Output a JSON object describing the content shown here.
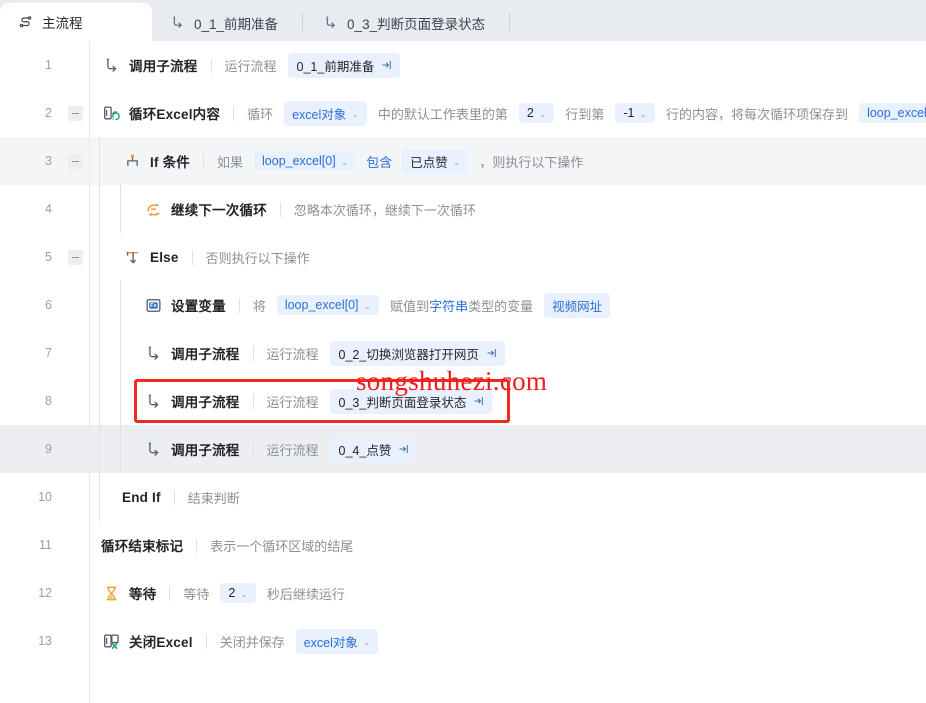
{
  "window": {
    "title": "主流程",
    "accent": "#2b6fd4",
    "highlight_color": "#ee2a23",
    "tabbar_bg": "#e8ecf1"
  },
  "tabs": [
    {
      "label": "主流程",
      "icon": "flow-icon",
      "active": true
    },
    {
      "label": "0_1_前期准备",
      "icon": "subflow-icon",
      "active": false
    },
    {
      "label": "0_3_判断页面登录状态",
      "icon": "subflow-icon",
      "active": false
    }
  ],
  "watermark": {
    "text": "songshuhezi.com",
    "color": "#ef1d1d"
  },
  "rows": [
    {
      "num": "1",
      "indent": 0,
      "collapsible": false,
      "shaded": false,
      "highlighted": false,
      "icon": "subflow-icon",
      "title": "调用子流程",
      "parts": [
        {
          "type": "text",
          "value": "运行流程"
        },
        {
          "type": "flow",
          "value": "0_1_前期准备"
        }
      ]
    },
    {
      "num": "2",
      "indent": 0,
      "collapsible": true,
      "shaded": false,
      "highlighted": false,
      "icon": "excel-loop-icon",
      "title": "循环Excel内容",
      "parts": [
        {
          "type": "text",
          "value": "循环"
        },
        {
          "type": "select",
          "value": "excel对象",
          "blue": true
        },
        {
          "type": "text",
          "value": "中的默认工作表里的第"
        },
        {
          "type": "select",
          "value": "2",
          "blue": false
        },
        {
          "type": "text",
          "value": "行到第"
        },
        {
          "type": "select",
          "value": "-1",
          "blue": false
        },
        {
          "type": "text",
          "value": "行的内容，将每次循环项保存到"
        },
        {
          "type": "var",
          "value": "loop_excel"
        }
      ]
    },
    {
      "num": "3",
      "indent": 1,
      "collapsible": true,
      "shaded": true,
      "highlighted": false,
      "icon": "if-icon",
      "title": "If 条件",
      "parts": [
        {
          "type": "text",
          "value": "如果"
        },
        {
          "type": "select",
          "value": "loop_excel[0]",
          "blue": true
        },
        {
          "type": "link",
          "value": "包含"
        },
        {
          "type": "select",
          "value": "已点赞",
          "blue": false
        },
        {
          "type": "text",
          "value": "，则执行以下操作"
        }
      ]
    },
    {
      "num": "4",
      "indent": 2,
      "collapsible": false,
      "shaded": false,
      "highlighted": false,
      "icon": "continue-loop-icon",
      "title": "继续下一次循环",
      "parts": [
        {
          "type": "text",
          "value": "忽略本次循环，继续下一次循环"
        }
      ]
    },
    {
      "num": "5",
      "indent": 1,
      "collapsible": true,
      "shaded": false,
      "highlighted": false,
      "icon": "else-icon",
      "title": "Else",
      "parts": [
        {
          "type": "text",
          "value": "否则执行以下操作"
        }
      ]
    },
    {
      "num": "6",
      "indent": 2,
      "collapsible": false,
      "shaded": false,
      "highlighted": false,
      "icon": "set-variable-icon",
      "title": "设置变量",
      "parts": [
        {
          "type": "text",
          "value": "将"
        },
        {
          "type": "select",
          "value": "loop_excel[0]",
          "blue": true
        },
        {
          "type": "mixed",
          "pre": "赋值到",
          "mid": "字符串",
          "post": "类型的变量"
        },
        {
          "type": "var",
          "value": "视频网址"
        }
      ]
    },
    {
      "num": "7",
      "indent": 2,
      "collapsible": false,
      "shaded": false,
      "highlighted": false,
      "icon": "subflow-icon",
      "title": "调用子流程",
      "parts": [
        {
          "type": "text",
          "value": "运行流程"
        },
        {
          "type": "flow",
          "value": "0_2_切换浏览器打开网页"
        }
      ]
    },
    {
      "num": "8",
      "indent": 2,
      "collapsible": false,
      "shaded": false,
      "highlighted": true,
      "icon": "subflow-icon",
      "title": "调用子流程",
      "parts": [
        {
          "type": "text",
          "value": "运行流程"
        },
        {
          "type": "flow",
          "value": "0_3_判断页面登录状态"
        }
      ]
    },
    {
      "num": "9",
      "indent": 2,
      "collapsible": false,
      "shaded": false,
      "hovered": true,
      "highlighted": false,
      "icon": "subflow-icon",
      "title": "调用子流程",
      "parts": [
        {
          "type": "text",
          "value": "运行流程"
        },
        {
          "type": "flow",
          "value": "0_4_点赞"
        }
      ]
    },
    {
      "num": "10",
      "indent": 1,
      "collapsible": false,
      "shaded": false,
      "highlighted": false,
      "icon": "none",
      "title": "End If",
      "parts": [
        {
          "type": "text",
          "value": "结束判断"
        }
      ]
    },
    {
      "num": "11",
      "indent": 0,
      "collapsible": false,
      "shaded": false,
      "highlighted": false,
      "icon": "none",
      "title": "循环结束标记",
      "parts": [
        {
          "type": "text",
          "value": "表示一个循环区域的结尾"
        }
      ]
    },
    {
      "num": "12",
      "indent": 0,
      "collapsible": false,
      "shaded": false,
      "highlighted": false,
      "icon": "wait-icon",
      "title": "等待",
      "parts": [
        {
          "type": "text",
          "value": "等待"
        },
        {
          "type": "select",
          "value": "2",
          "blue": false
        },
        {
          "type": "text",
          "value": "秒后继续运行"
        }
      ]
    },
    {
      "num": "13",
      "indent": 0,
      "collapsible": false,
      "shaded": false,
      "highlighted": false,
      "icon": "excel-close-icon",
      "title": "关闭Excel",
      "parts": [
        {
          "type": "text",
          "value": "关闭并保存"
        },
        {
          "type": "select",
          "value": "excel对象",
          "blue": true
        }
      ]
    }
  ]
}
